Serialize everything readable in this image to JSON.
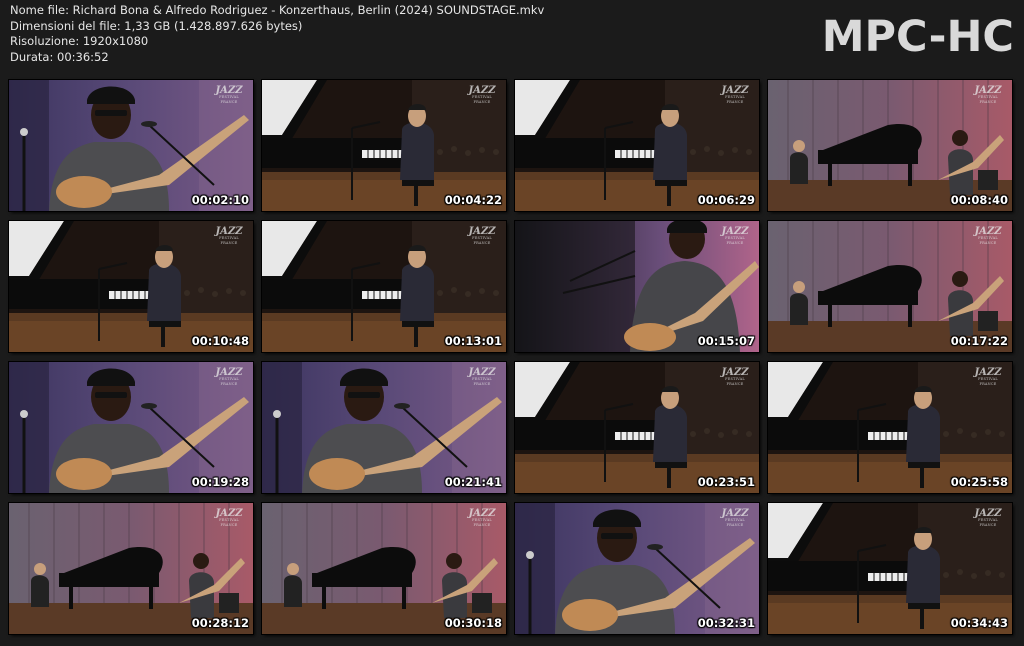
{
  "header": {
    "file_name": "Nome file: Richard Bona & Alfredo Rodriguez - Konzerthaus, Berlin (2024) SOUNDSTAGE.mkv",
    "file_size": "Dimensioni del file: 1,33 GB (1.428.897.626 bytes)",
    "resolution": "Risoluzione: 1920x1080",
    "duration": "Durata: 00:36:52"
  },
  "brand": "MPC-HC",
  "logo": {
    "mark": "JAZZ",
    "sub": "FESTIVAL FRANCE"
  },
  "thumbnails": [
    {
      "timestamp": "00:02:10",
      "scene": "bassist-closeup"
    },
    {
      "timestamp": "00:04:22",
      "scene": "pianist"
    },
    {
      "timestamp": "00:06:29",
      "scene": "pianist"
    },
    {
      "timestamp": "00:08:40",
      "scene": "stage-wide"
    },
    {
      "timestamp": "00:10:48",
      "scene": "pianist"
    },
    {
      "timestamp": "00:13:01",
      "scene": "pianist"
    },
    {
      "timestamp": "00:15:07",
      "scene": "bassist-wide"
    },
    {
      "timestamp": "00:17:22",
      "scene": "stage-wide"
    },
    {
      "timestamp": "00:19:28",
      "scene": "bassist-closeup"
    },
    {
      "timestamp": "00:21:41",
      "scene": "bassist-closeup"
    },
    {
      "timestamp": "00:23:51",
      "scene": "pianist"
    },
    {
      "timestamp": "00:25:58",
      "scene": "pianist"
    },
    {
      "timestamp": "00:28:12",
      "scene": "stage-wide"
    },
    {
      "timestamp": "00:30:18",
      "scene": "stage-wide"
    },
    {
      "timestamp": "00:32:31",
      "scene": "bassist-closeup"
    },
    {
      "timestamp": "00:34:43",
      "scene": "pianist"
    }
  ]
}
